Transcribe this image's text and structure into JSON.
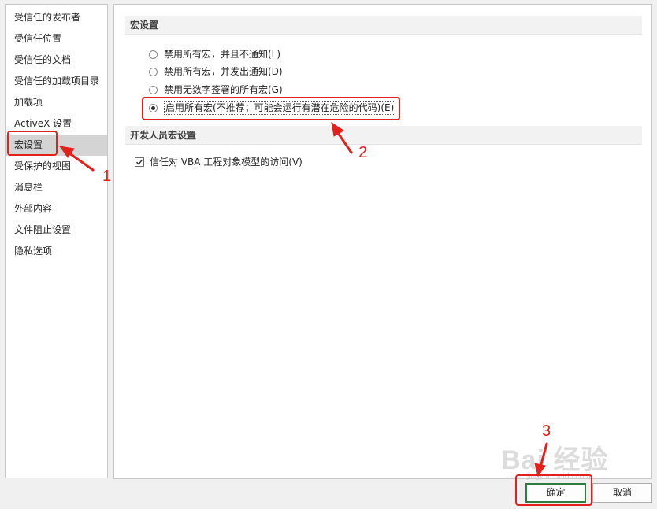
{
  "sidebar": {
    "items": [
      {
        "label": "受信任的发布者"
      },
      {
        "label": "受信任位置"
      },
      {
        "label": "受信任的文档"
      },
      {
        "label": "受信任的加载项目录"
      },
      {
        "label": "加载项"
      },
      {
        "label": "ActiveX 设置"
      },
      {
        "label": "宏设置",
        "selected": true
      },
      {
        "label": "受保护的视图"
      },
      {
        "label": "消息栏"
      },
      {
        "label": "外部内容"
      },
      {
        "label": "文件阻止设置"
      },
      {
        "label": "隐私选项"
      }
    ]
  },
  "macro_section": {
    "title": "宏设置",
    "options": [
      {
        "label": "禁用所有宏，并且不通知(L)",
        "checked": false
      },
      {
        "label": "禁用所有宏，并发出通知(D)",
        "checked": false
      },
      {
        "label": "禁用无数字签署的所有宏(G)",
        "checked": false
      },
      {
        "label": "启用所有宏(不推荐；可能会运行有潜在危险的代码)(E)",
        "checked": true
      }
    ]
  },
  "developer_section": {
    "title": "开发人员宏设置",
    "trust_vba_label": "信任对 VBA 工程对象模型的访问(V)",
    "trust_vba_checked": true
  },
  "buttons": {
    "ok_label": "确定",
    "cancel_label": "取消"
  },
  "annotations": {
    "step1": "1",
    "step2": "2",
    "step3": "3",
    "color": "#e3201b"
  },
  "watermark": {
    "text": "Bai 经验",
    "sub": "jingyan.baidu.com"
  }
}
